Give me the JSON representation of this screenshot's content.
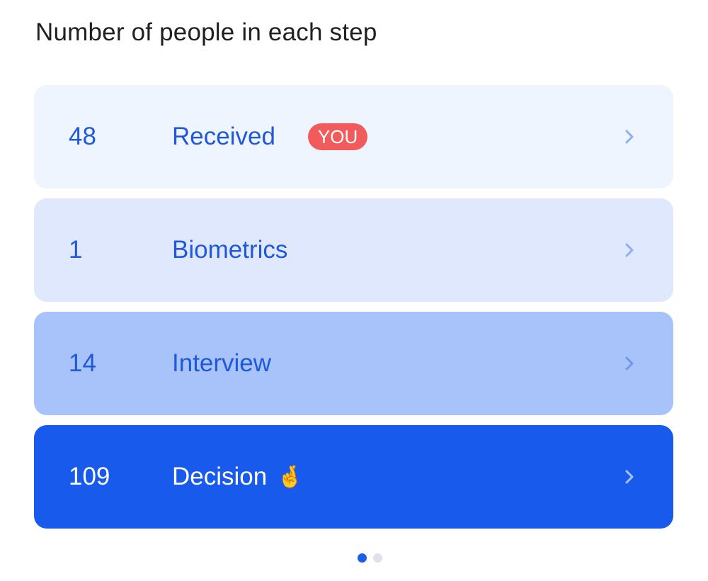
{
  "title": "Number of people in each step",
  "steps": [
    {
      "count": "48",
      "label": "Received",
      "badge": "YOU",
      "emoji": ""
    },
    {
      "count": "1",
      "label": "Biometrics",
      "badge": "",
      "emoji": ""
    },
    {
      "count": "14",
      "label": "Interview",
      "badge": "",
      "emoji": ""
    },
    {
      "count": "109",
      "label": "Decision",
      "badge": "",
      "emoji": "🤞"
    }
  ],
  "icons": {
    "chevron": "chevron-right-icon"
  },
  "colors": {
    "step_backgrounds": [
      "#eff5fe",
      "#dfe8fc",
      "#a8c3fa",
      "#175aec"
    ],
    "text_blue": "#1f58d8",
    "badge_red": "#f25b5b",
    "chevron_light": "#8eb0f2",
    "chevron_dark": "#a9c2f8"
  },
  "pagination": {
    "total": 2,
    "active": 1
  }
}
